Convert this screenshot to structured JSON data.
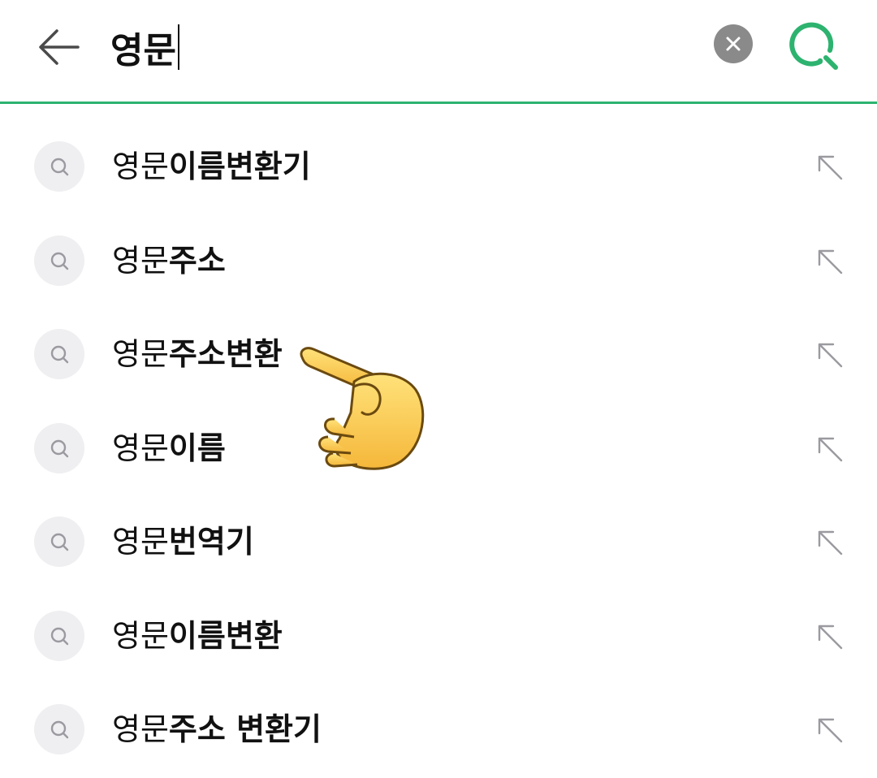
{
  "search": {
    "query": "영문",
    "accent_color": "#2db36f"
  },
  "icons": {
    "back": "arrow-left-icon",
    "clear": "clear-x-icon",
    "search": "search-icon",
    "suggestion": "search-icon",
    "fill": "arrow-up-left-icon"
  },
  "suggestions": [
    {
      "prefix": "영문",
      "suffix": "이름변환기"
    },
    {
      "prefix": "영문",
      "suffix": "주소"
    },
    {
      "prefix": "영문",
      "suffix": "주소변환"
    },
    {
      "prefix": "영문",
      "suffix": "이름"
    },
    {
      "prefix": "영문",
      "suffix": "번역기"
    },
    {
      "prefix": "영문",
      "suffix": "이름변환"
    },
    {
      "prefix": "영문",
      "suffix": "주소 변환기"
    }
  ]
}
